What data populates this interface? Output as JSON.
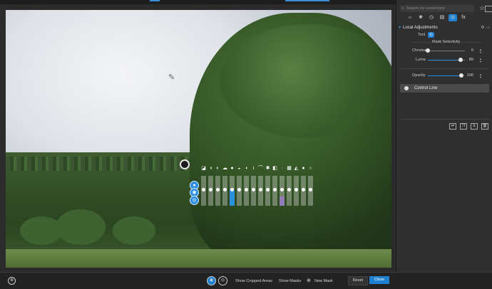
{
  "search": {
    "placeholder": "Search for corrections"
  },
  "panel": {
    "section_title": "Local Adjustments",
    "tool_label": "Tool",
    "mask_selectivity_label": "Mask Selectivity",
    "chroma_label": "Chroma",
    "chroma_value": "0",
    "chroma_level": 0.0,
    "luma_label": "Luma",
    "luma_value": "89",
    "luma_level": 0.89,
    "opacity_label": "Opacity",
    "opacity_value": "100",
    "opacity_level": 1.0,
    "mask_item_label": "Control Line",
    "tabs": [
      "sun-icon",
      "color-wheel-icon",
      "detail-icon",
      "geometry-icon",
      "local-icon",
      "fx-icon"
    ],
    "active_tab_index": 4,
    "fx_label": "fx"
  },
  "bottom": {
    "show_cropped_label": "Show Cropped Areas",
    "show_masks_label": "Show Masks",
    "new_mask_label": "New Mask",
    "reset_label": "Reset",
    "close_label": "Close"
  },
  "tool_bars": {
    "count": 16,
    "highlighted": [
      4,
      11
    ],
    "accent": "#2b8fe0"
  },
  "colors": {
    "accent": "#1f7fd0",
    "panel_bg": "#2f2f2f"
  }
}
